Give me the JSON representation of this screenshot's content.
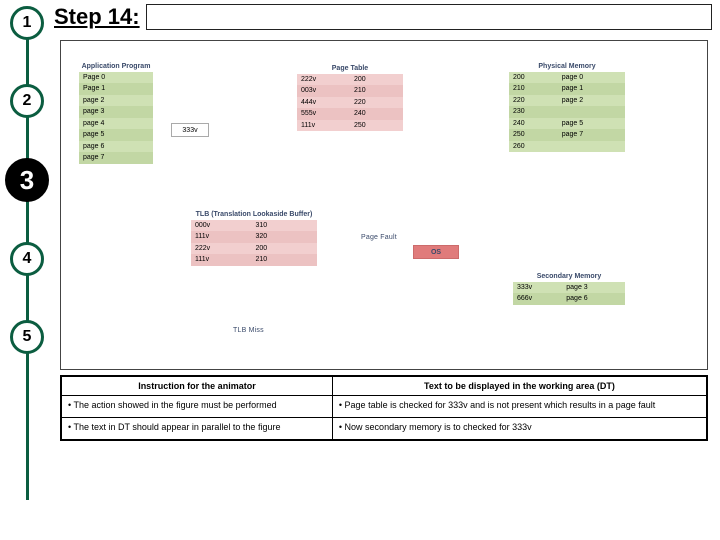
{
  "header": {
    "title": "Step 14:"
  },
  "steps": [
    "1",
    "2",
    "3",
    "4",
    "5"
  ],
  "diagram": {
    "app_program": {
      "caption": "Application Program",
      "rows": [
        "Page 0",
        "Page 1",
        "page 2",
        "page 3",
        "page 4",
        "page 5",
        "page 6",
        "page 7"
      ]
    },
    "address_box": "333v",
    "page_table": {
      "caption": "Page Table",
      "rows": [
        [
          "222v",
          "200"
        ],
        [
          "003v",
          "210"
        ],
        [
          "444v",
          "220"
        ],
        [
          "555v",
          "240"
        ],
        [
          "111v",
          "250"
        ]
      ]
    },
    "physical_memory": {
      "caption": "Physical Memory",
      "rows": [
        [
          "200",
          "page 0"
        ],
        [
          "210",
          "page 1"
        ],
        [
          "220",
          "page 2"
        ],
        [
          "230",
          ""
        ],
        [
          "240",
          "page 5"
        ],
        [
          "250",
          "page 7"
        ],
        [
          "260",
          ""
        ]
      ]
    },
    "tlb": {
      "caption": "TLB (Translation Lookaside Buffer)",
      "rows": [
        [
          "000v",
          "310"
        ],
        [
          "111v",
          "320"
        ],
        [
          "222v",
          "200"
        ],
        [
          "111v",
          "210"
        ],
        [
          "",
          ""
        ]
      ]
    },
    "tlb_miss_label": "TLB Miss",
    "page_fault_label": "Page Fault",
    "os_label": "OS",
    "secondary_memory": {
      "caption": "Secondary Memory",
      "rows": [
        [
          "333v",
          "page 3"
        ],
        [
          "666v",
          "page 6"
        ]
      ]
    }
  },
  "instruction": {
    "head": {
      "left": "Instruction for the animator",
      "right": "Text to be displayed in the working area (DT)"
    },
    "rows": [
      {
        "left": "The action showed in the figure must be performed",
        "right": "Page table is checked for 333v and is not present which results in a page fault"
      },
      {
        "left": "The text in DT should appear in parallel to the figure",
        "right": "Now secondary memory is to checked for 333v"
      }
    ]
  }
}
